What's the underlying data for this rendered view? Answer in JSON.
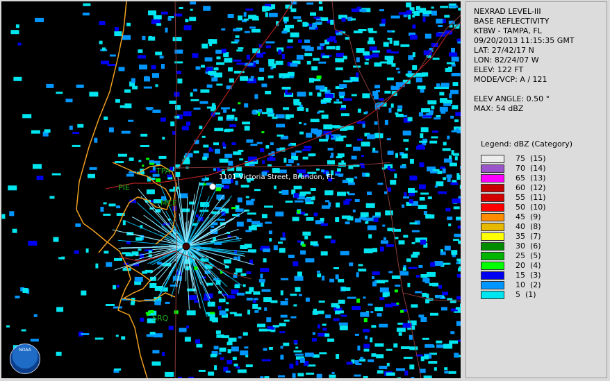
{
  "info": {
    "product": "NEXRAD LEVEL-III",
    "type": "BASE REFLECTIVITY",
    "station": "KTBW - TAMPA, FL",
    "datetime": "09/20/2013 11:15:35 GMT",
    "lat": "LAT: 27/42/17 N",
    "lon": "LON: 82/24/07 W",
    "elev": "ELEV: 122 FT",
    "mode": "MODE/VCP: A / 121",
    "elev_angle": "ELEV ANGLE: 0.50 °",
    "max": "MAX: 54 dBZ"
  },
  "legend": {
    "title": "Legend: dBZ (Category)",
    "items": [
      {
        "label": "75  (15)",
        "color": "#ececec"
      },
      {
        "label": "70  (14)",
        "color": "#9955c9"
      },
      {
        "label": "65  (13)",
        "color": "#ff00ff"
      },
      {
        "label": "60  (12)",
        "color": "#c80000"
      },
      {
        "label": "55  (11)",
        "color": "#d40000"
      },
      {
        "label": "50  (10)",
        "color": "#ff0000"
      },
      {
        "label": "45  (9)",
        "color": "#ff8c00"
      },
      {
        "label": "40  (8)",
        "color": "#e6b800"
      },
      {
        "label": "35  (7)",
        "color": "#ffff00"
      },
      {
        "label": "30  (6)",
        "color": "#008c00"
      },
      {
        "label": "25  (5)",
        "color": "#00b400"
      },
      {
        "label": "20  (4)",
        "color": "#00ff00"
      },
      {
        "label": "15  (3)",
        "color": "#0000f0"
      },
      {
        "label": "10  (2)",
        "color": "#0096ff"
      },
      {
        "label": "5  (1)",
        "color": "#00e6f0"
      }
    ]
  },
  "map": {
    "address_label": "1101 Victoria Street, Brandon, FL",
    "places": {
      "tpa": "TPA",
      "pie": "PIE",
      "mcf": "MCF",
      "srq": "SRQ"
    },
    "logo_text": "NOAA"
  }
}
